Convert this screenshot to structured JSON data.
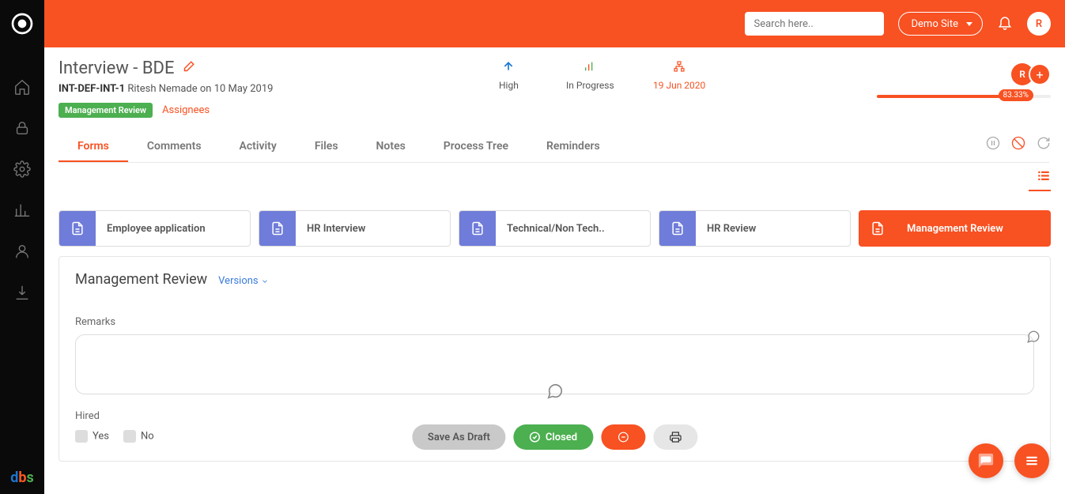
{
  "topbar": {
    "search_placeholder": "Search here..",
    "site_label": "Demo Site",
    "avatar_initial": "R"
  },
  "sidebar": {
    "logo_alt": "app-logo",
    "bottom_logo": "dbs"
  },
  "header": {
    "title": "Interview - BDE",
    "ref_code": "INT-DEF-INT-1",
    "author": "Ritesh Nemade",
    "created_on_label": "on",
    "created_date": "10 May 2019",
    "stage_badge": "Management Review",
    "assignees_label": "Assignees",
    "avatar_initial": "R"
  },
  "status": {
    "priority_label": "High",
    "state_label": "In Progress",
    "due_date": "19 Jun 2020"
  },
  "progress": {
    "percent_label": "83.33%",
    "percent_value": 83.33
  },
  "tabs": [
    {
      "label": "Forms",
      "active": true
    },
    {
      "label": "Comments"
    },
    {
      "label": "Activity"
    },
    {
      "label": "Files"
    },
    {
      "label": "Notes"
    },
    {
      "label": "Process Tree"
    },
    {
      "label": "Reminders"
    }
  ],
  "form_stages": [
    {
      "label": "Employee application"
    },
    {
      "label": "HR Interview"
    },
    {
      "label": "Technical/Non Tech.."
    },
    {
      "label": "HR Review"
    },
    {
      "label": "Management Review",
      "active": true
    }
  ],
  "panel": {
    "title": "Management Review",
    "versions_label": "Versions",
    "remarks_label": "Remarks",
    "remarks_value": "",
    "hired_label": "Hired",
    "option_yes": "Yes",
    "option_no": "No"
  },
  "actions": {
    "draft": "Save As Draft",
    "closed": "Closed"
  }
}
